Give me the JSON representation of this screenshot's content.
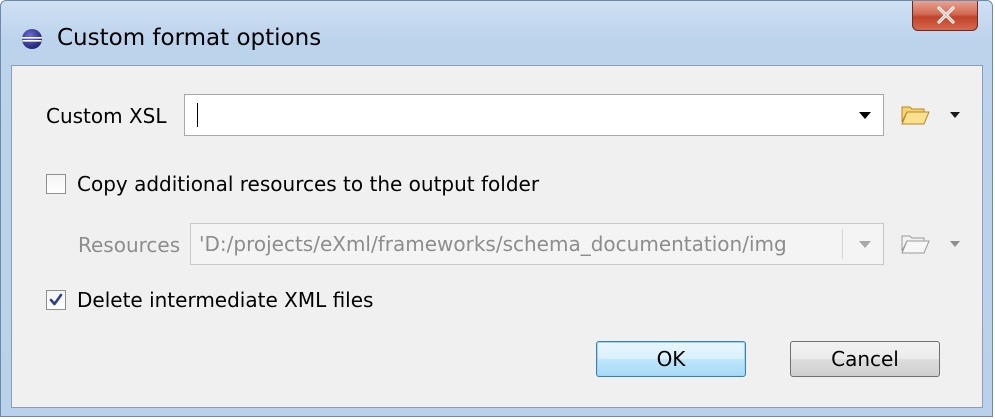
{
  "window": {
    "title": "Custom format options",
    "app_icon": "eclipse-sphere-icon",
    "close_icon": "close-icon"
  },
  "form": {
    "custom_xsl": {
      "label": "Custom XSL",
      "value": ""
    },
    "copy_resources": {
      "label": "Copy additional resources to the output folder",
      "checked": false
    },
    "resources": {
      "label": "Resources",
      "value": "'D:/projects/eXml/frameworks/schema_documentation/img",
      "enabled": false
    },
    "delete_intermediate": {
      "label": "Delete intermediate XML files",
      "checked": true
    }
  },
  "buttons": {
    "ok_label": "OK",
    "cancel_label": "Cancel"
  },
  "colors": {
    "frame": "#b9d1ea",
    "content_bg": "#f0f0f0",
    "close_button": "#c0432a",
    "default_button_border": "#3c7fb1"
  }
}
